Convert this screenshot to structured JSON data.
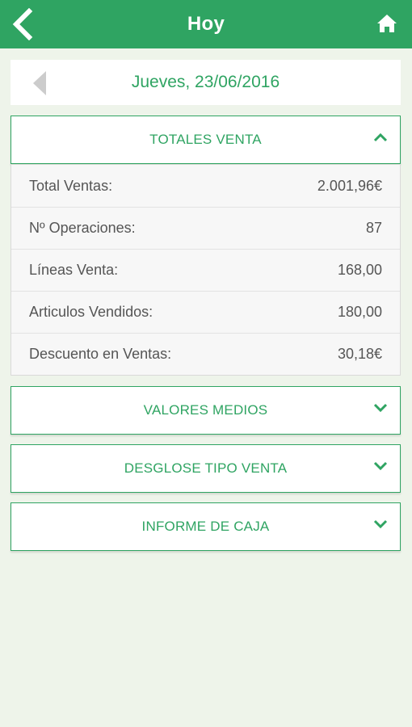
{
  "header": {
    "title": "Hoy",
    "back_icon": "chevron-left-icon",
    "home_icon": "home-icon"
  },
  "date_nav": {
    "prev_icon": "triangle-left-icon",
    "date": "Jueves, 23/06/2016"
  },
  "sections": [
    {
      "label": "TOTALES VENTA",
      "expanded": true
    },
    {
      "label": "VALORES MEDIOS",
      "expanded": false
    },
    {
      "label": "DESGLOSE TIPO VENTA",
      "expanded": false
    },
    {
      "label": "INFORME DE CAJA",
      "expanded": false
    }
  ],
  "totales": [
    {
      "label": "Total Ventas:",
      "value": "2.001,96€"
    },
    {
      "label": "Nº Operaciones:",
      "value": "87"
    },
    {
      "label": "Líneas Venta:",
      "value": "168,00"
    },
    {
      "label": "Articulos Vendidos:",
      "value": "180,00"
    },
    {
      "label": "Descuento en Ventas:",
      "value": "30,18€"
    }
  ],
  "colors": {
    "accent": "#2fa462",
    "background": "#eef4ea"
  }
}
